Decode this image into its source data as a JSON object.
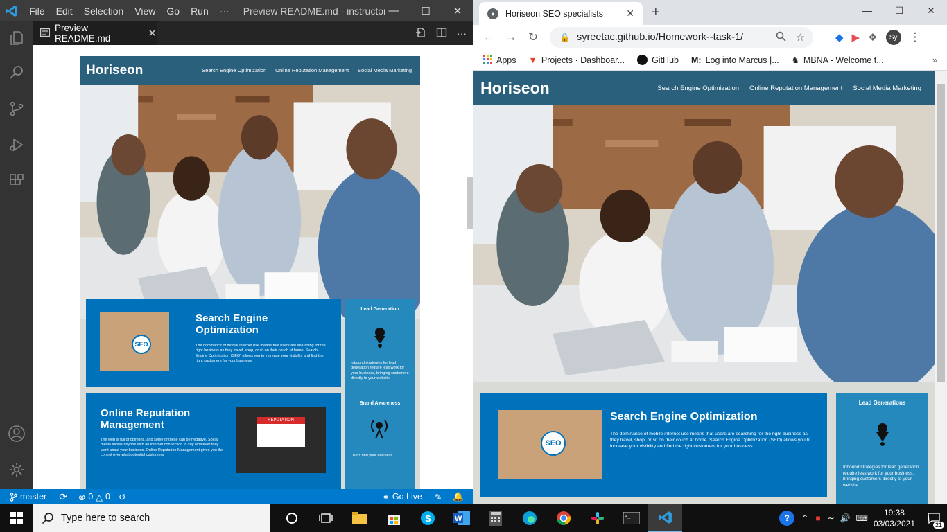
{
  "vscode": {
    "menu": [
      "File",
      "Edit",
      "Selection",
      "View",
      "Go",
      "Run",
      "···"
    ],
    "window_title": "Preview README.md - instructor - Vis...",
    "tab_label": "Preview README.md",
    "status": {
      "branch": "master",
      "errors": "0",
      "warnings": "0",
      "golive": "Go Live"
    }
  },
  "site": {
    "logo": "Horiseon",
    "nav": [
      "Search Engine Optimization",
      "Online Reputation Management",
      "Social Media Marketing"
    ],
    "seo": {
      "title": "Search Engine Optimization",
      "body": "The dominance of mobile internet use means that users are searching for the right business as they travel, shop, or sit on their couch at home. Search Engine Optimization (SEO) allows you to increase your visibility and find the right customers for your business."
    },
    "orm": {
      "title": "Online Reputation Management",
      "body": "The web is full of opinions, and some of these can be negative. Social media allows anyone with an internet connection to say whatever they want about your business. Online Reputation Management gives you the control over what potential customers"
    },
    "aside_lead_vs": "Lead Generation",
    "aside_lead_ch": "Lead Generations",
    "aside_lead_body": "Inbound strategies for lead generation require less work for your business, bringing customers directly to your website.",
    "aside_brand": "Brand Awareness",
    "aside_brand_body": "Users find your business",
    "seo_img_text": "SEO",
    "rep_img_text": "REPUTATION"
  },
  "chrome": {
    "tab_title": "Horiseon SEO specialists",
    "url": "syreetac.github.io/Homework--task-1/",
    "avatar": "Sy",
    "bookmarks": [
      "Apps",
      "Projects · Dashboar...",
      "GitHub",
      "Log into Marcus |...",
      "MBNA - Welcome t..."
    ]
  },
  "taskbar": {
    "search_placeholder": "Type here to search",
    "time": "19:38",
    "date": "03/03/2021",
    "notif": "21"
  }
}
